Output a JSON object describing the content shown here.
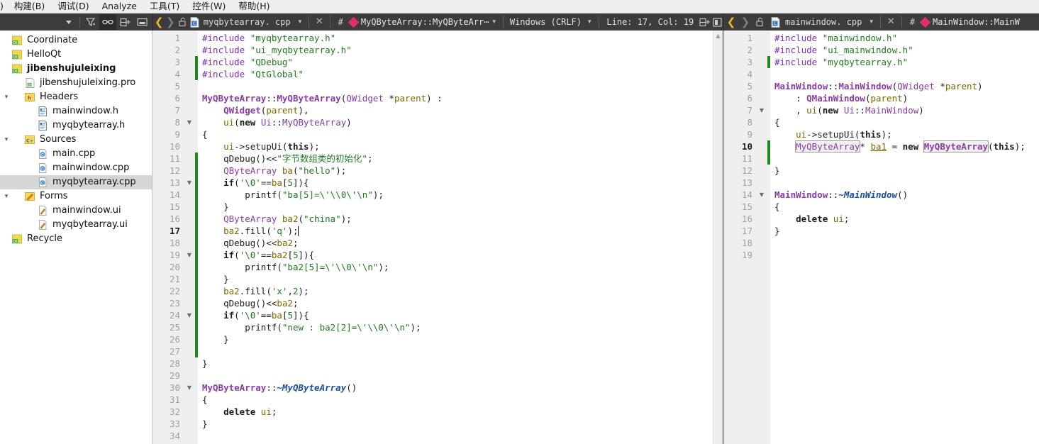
{
  "menubar": {
    "items": [
      {
        "label": ")",
        "mnemonic": ""
      },
      {
        "label": "构建(B)",
        "mnemonic": "B"
      },
      {
        "label": "调试(D)",
        "mnemonic": "D"
      },
      {
        "label": "Analyze",
        "mnemonic": "A"
      },
      {
        "label": "工具(T)",
        "mnemonic": "T"
      },
      {
        "label": "控件(W)",
        "mnemonic": "W"
      },
      {
        "label": "帮助(H)",
        "mnemonic": "H"
      }
    ]
  },
  "sidebar_toolbar": {
    "icons": [
      {
        "name": "view-dropdown-icon",
        "glyph": "▾",
        "active": false
      },
      {
        "name": "filter-icon",
        "glyph": "filter",
        "active": false
      },
      {
        "name": "synchronize-link-icon",
        "glyph": "link",
        "active": true
      },
      {
        "name": "add-split-icon",
        "glyph": "split-add",
        "active": false
      },
      {
        "name": "collapse-panel-icon",
        "glyph": "minimize",
        "active": false
      }
    ]
  },
  "left_editor_toolbar": {
    "back_arrow": "❮",
    "forward_arrow": "❯",
    "lock_icon": "unlocked-padlock-icon",
    "file_icon": "cpp-file-icon",
    "filename": "myqbytearray. cpp",
    "dropdown_arrow": "▾",
    "close_label": "✕",
    "hash_label": "#",
    "symbol": "MyQByteArray::MyQByteArr⋯",
    "symbol_dropdown": "▾",
    "encoding": "Windows (CRLF)",
    "encoding_dropdown": "▾",
    "cursor_position": "Line: 17, Col: 19",
    "split_icon": "split-editor-icon",
    "close_split_icon": "close-split-icon"
  },
  "right_editor_toolbar": {
    "back_arrow": "❮",
    "forward_arrow": "❯",
    "lock_icon": "unlocked-padlock-icon",
    "file_icon": "cpp-file-icon",
    "filename": "mainwindow. cpp",
    "dropdown_arrow": "▾",
    "close_label": "✕",
    "hash_label": "#",
    "symbol": "MainWindow::MainW"
  },
  "sidebar": {
    "items": [
      {
        "label": "Coordinate",
        "indent": 0,
        "icon": "qt-project-icon",
        "twisty": "",
        "bold": false,
        "selected": false
      },
      {
        "label": "HelloQt",
        "indent": 0,
        "icon": "qt-project-icon",
        "twisty": "",
        "bold": false,
        "selected": false
      },
      {
        "label": "jibenshujuleixing",
        "indent": 0,
        "icon": "qt-project-icon",
        "twisty": "",
        "bold": true,
        "selected": false
      },
      {
        "label": "jibenshujuleixing.pro",
        "indent": 1,
        "icon": "pro-file-icon",
        "twisty": "",
        "bold": false,
        "selected": false
      },
      {
        "label": "Headers",
        "indent": 1,
        "icon": "headers-folder-icon",
        "twisty": "▾",
        "bold": false,
        "selected": false
      },
      {
        "label": "mainwindow.h",
        "indent": 2,
        "icon": "header-file-icon",
        "twisty": "",
        "bold": false,
        "selected": false
      },
      {
        "label": "myqbytearray.h",
        "indent": 2,
        "icon": "header-file-icon",
        "twisty": "",
        "bold": false,
        "selected": false
      },
      {
        "label": "Sources",
        "indent": 1,
        "icon": "sources-folder-icon",
        "twisty": "▾",
        "bold": false,
        "selected": false
      },
      {
        "label": "main.cpp",
        "indent": 2,
        "icon": "cpp-file-icon",
        "twisty": "",
        "bold": false,
        "selected": false
      },
      {
        "label": "mainwindow.cpp",
        "indent": 2,
        "icon": "cpp-file-icon",
        "twisty": "",
        "bold": false,
        "selected": false
      },
      {
        "label": "myqbytearray.cpp",
        "indent": 2,
        "icon": "cpp-file-icon",
        "twisty": "",
        "bold": false,
        "selected": true
      },
      {
        "label": "Forms",
        "indent": 1,
        "icon": "forms-folder-icon",
        "twisty": "▾",
        "bold": false,
        "selected": false
      },
      {
        "label": "mainwindow.ui",
        "indent": 2,
        "icon": "ui-file-icon",
        "twisty": "",
        "bold": false,
        "selected": false
      },
      {
        "label": "myqbytearray.ui",
        "indent": 2,
        "icon": "ui-file-icon",
        "twisty": "",
        "bold": false,
        "selected": false
      },
      {
        "label": "Recycle",
        "indent": 0,
        "icon": "qt-project-icon",
        "twisty": "",
        "bold": false,
        "selected": false
      }
    ]
  },
  "left_editor": {
    "total_lines": 34,
    "current_line": 17,
    "change_marker_lines": [
      3,
      4,
      11,
      12,
      13,
      14,
      15,
      16,
      17,
      18,
      19,
      20,
      21,
      22,
      23,
      24,
      25,
      26,
      27
    ],
    "fold_marker_lines": [
      8,
      13,
      19,
      24,
      30
    ],
    "lines": [
      {
        "n": 1,
        "text": "#include \"myqbytearray.h\""
      },
      {
        "n": 2,
        "text": "#include \"ui_myqbytearray.h\""
      },
      {
        "n": 3,
        "text": "#include \"QDebug\""
      },
      {
        "n": 4,
        "text": "#include \"QtGlobal\""
      },
      {
        "n": 5,
        "text": ""
      },
      {
        "n": 6,
        "text": "MyQByteArray::MyQByteArray(QWidget *parent) :"
      },
      {
        "n": 7,
        "text": "    QWidget(parent),"
      },
      {
        "n": 8,
        "text": "    ui(new Ui::MyQByteArray)"
      },
      {
        "n": 9,
        "text": "{"
      },
      {
        "n": 10,
        "text": "    ui->setupUi(this);"
      },
      {
        "n": 11,
        "text": "    qDebug()<<\"字节数组类的初始化\";"
      },
      {
        "n": 12,
        "text": "    QByteArray ba(\"hello\");"
      },
      {
        "n": 13,
        "text": "    if('\\0'==ba[5]){"
      },
      {
        "n": 14,
        "text": "        printf(\"ba[5]=\\'\\\\0\\'\\n\");"
      },
      {
        "n": 15,
        "text": "    }"
      },
      {
        "n": 16,
        "text": "    QByteArray ba2(\"china\");"
      },
      {
        "n": 17,
        "text": "    ba2.fill('q');"
      },
      {
        "n": 18,
        "text": "    qDebug()<<ba2;"
      },
      {
        "n": 19,
        "text": "    if('\\0'==ba2[5]){"
      },
      {
        "n": 20,
        "text": "        printf(\"ba2[5]=\\'\\\\0\\'\\n\");"
      },
      {
        "n": 21,
        "text": "    }"
      },
      {
        "n": 22,
        "text": "    ba2.fill('x',2);"
      },
      {
        "n": 23,
        "text": "    qDebug()<<ba2;"
      },
      {
        "n": 24,
        "text": "    if('\\0'==ba[5]){"
      },
      {
        "n": 25,
        "text": "        printf(\"new : ba2[2]=\\'\\\\0\\'\\n\");"
      },
      {
        "n": 26,
        "text": "    }"
      },
      {
        "n": 27,
        "text": ""
      },
      {
        "n": 28,
        "text": "}"
      },
      {
        "n": 29,
        "text": ""
      },
      {
        "n": 30,
        "text": "MyQByteArray::~MyQByteArray()"
      },
      {
        "n": 31,
        "text": "{"
      },
      {
        "n": 32,
        "text": "    delete ui;"
      },
      {
        "n": 33,
        "text": "}"
      },
      {
        "n": 34,
        "text": ""
      }
    ]
  },
  "right_editor": {
    "total_lines": 19,
    "current_line": 10,
    "change_marker_lines": [
      3,
      10,
      11
    ],
    "fold_marker_lines": [
      7,
      14
    ],
    "lines": [
      {
        "n": 1,
        "text": "#include \"mainwindow.h\""
      },
      {
        "n": 2,
        "text": "#include \"ui_mainwindow.h\""
      },
      {
        "n": 3,
        "text": "#include \"myqbytearray.h\""
      },
      {
        "n": 4,
        "text": ""
      },
      {
        "n": 5,
        "text": "MainWindow::MainWindow(QWidget *parent)"
      },
      {
        "n": 6,
        "text": "    : QMainWindow(parent)"
      },
      {
        "n": 7,
        "text": "    , ui(new Ui::MainWindow)"
      },
      {
        "n": 8,
        "text": "{"
      },
      {
        "n": 9,
        "text": "    ui->setupUi(this);"
      },
      {
        "n": 10,
        "text": "    MyQByteArray* ba1 = new MyQByteArray(this);"
      },
      {
        "n": 11,
        "text": ""
      },
      {
        "n": 12,
        "text": "}"
      },
      {
        "n": 13,
        "text": ""
      },
      {
        "n": 14,
        "text": "MainWindow::~MainWindow()"
      },
      {
        "n": 15,
        "text": "{"
      },
      {
        "n": 16,
        "text": "    delete ui;"
      },
      {
        "n": 17,
        "text": "}"
      },
      {
        "n": 18,
        "text": ""
      },
      {
        "n": 19,
        "text": ""
      }
    ]
  },
  "colors": {
    "toolbar_bg": "#3c3c3c",
    "menubar_bg": "#efeff1",
    "gutter_bg": "#efefef",
    "editor_bg": "#ffffff",
    "selection_bg": "#d6d6d6",
    "change_marker": "#1a8a1a",
    "symbol_marker": "#e02f6b",
    "back_arrow": "#e8b52c",
    "string": "#1f7a1f",
    "preprocessor": "#7b2fb5",
    "class_name": "#8b3ba6",
    "variable": "#7a6a00",
    "destructor": "#1c4fa0"
  }
}
